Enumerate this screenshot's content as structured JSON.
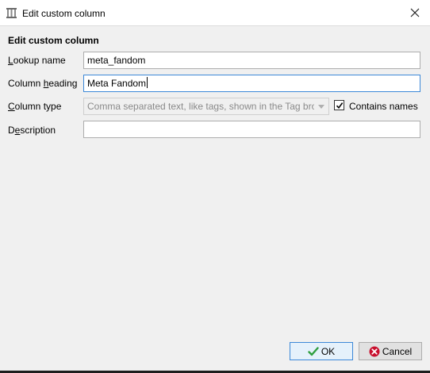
{
  "window": {
    "title": "Edit custom column",
    "app_icon": "calibre-library-icon",
    "close_icon": "close-icon"
  },
  "form": {
    "heading": "Edit custom column",
    "lookup_name": {
      "label_underlined": "L",
      "label_rest": "ookup name",
      "value": "meta_fandom"
    },
    "column_heading": {
      "label_prefix": "Column ",
      "label_underlined": "h",
      "label_rest": "eading",
      "value": "Meta Fandom"
    },
    "column_type": {
      "label_underlined": "C",
      "label_rest": "olumn type",
      "selected": "Comma separated text, like tags, shown in the Tag browser",
      "disabled": true
    },
    "contains_names": {
      "label": "Contains names",
      "checked": true
    },
    "description": {
      "label_prefix": "D",
      "label_underlined": "e",
      "label_rest": "scription",
      "value": ""
    }
  },
  "buttons": {
    "ok_label": "OK",
    "ok_icon": "checkmark-icon",
    "cancel_label": "Cancel",
    "cancel_icon": "cancel-icon"
  },
  "colors": {
    "focus_border": "#3c88d8",
    "ok_green": "#2e9e3e",
    "cancel_red": "#c8102e"
  }
}
